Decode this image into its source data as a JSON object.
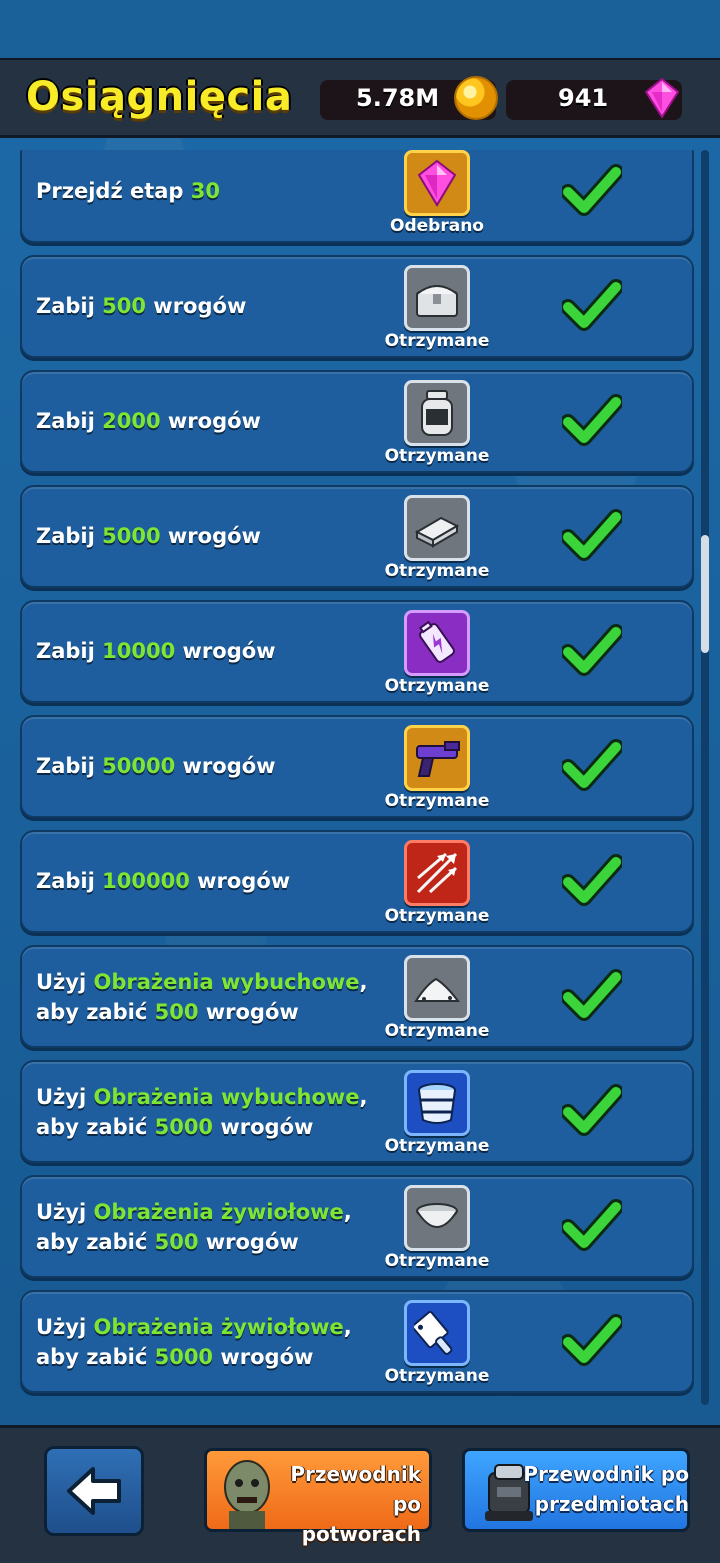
{
  "header": {
    "title": "Osiągnięcia",
    "coins": "5.78M",
    "gems": "941"
  },
  "achievements": [
    {
      "pre": "Przejdź etap ",
      "hl": "30",
      "post": "",
      "line2_pre": "",
      "line2_hl": "",
      "line2_post": "",
      "reward_icon": "gem-icon",
      "reward_label": "Odebrano"
    },
    {
      "pre": "Zabij ",
      "hl": "500",
      "post": " wrogów",
      "line2_pre": "",
      "line2_hl": "",
      "line2_post": "",
      "reward_icon": "chest-icon",
      "reward_label": "Otrzymane"
    },
    {
      "pre": "Zabij ",
      "hl": "2000",
      "post": " wrogów",
      "line2_pre": "",
      "line2_hl": "",
      "line2_post": "",
      "reward_icon": "jar-icon",
      "reward_label": "Otrzymane"
    },
    {
      "pre": "Zabij ",
      "hl": "5000",
      "post": " wrogów",
      "line2_pre": "",
      "line2_hl": "",
      "line2_post": "",
      "reward_icon": "ammo-box-icon",
      "reward_label": "Otrzymane"
    },
    {
      "pre": "Zabij ",
      "hl": "10000",
      "post": " wrogów",
      "line2_pre": "",
      "line2_hl": "",
      "line2_post": "",
      "reward_icon": "battery-icon",
      "reward_label": "Otrzymane"
    },
    {
      "pre": "Zabij ",
      "hl": "50000",
      "post": " wrogów",
      "line2_pre": "",
      "line2_hl": "",
      "line2_post": "",
      "reward_icon": "blaster-icon",
      "reward_label": "Otrzymane"
    },
    {
      "pre": "Zabij ",
      "hl": "100000",
      "post": " wrogów",
      "line2_pre": "",
      "line2_hl": "",
      "line2_post": "",
      "reward_icon": "arrows-icon",
      "reward_label": "Otrzymane"
    },
    {
      "pre": "Użyj ",
      "hl": "Obrażenia wybuchowe",
      "post": ",",
      "line2_pre": "aby zabić ",
      "line2_hl": "500",
      "line2_post": " wrogów",
      "reward_icon": "powder-pile-icon",
      "reward_label": "Otrzymane"
    },
    {
      "pre": "Użyj ",
      "hl": "Obrażenia wybuchowe",
      "post": ",",
      "line2_pre": "aby zabić ",
      "line2_hl": "5000",
      "line2_post": " wrogów",
      "reward_icon": "barrel-icon",
      "reward_label": "Otrzymane"
    },
    {
      "pre": "Użyj ",
      "hl": "Obrażenia żywiołowe",
      "post": ",",
      "line2_pre": "aby zabić ",
      "line2_hl": "500",
      "line2_post": " wrogów",
      "reward_icon": "bowl-icon",
      "reward_label": "Otrzymane"
    },
    {
      "pre": "Użyj ",
      "hl": "Obrażenia żywiołowe",
      "post": ",",
      "line2_pre": "aby zabić ",
      "line2_hl": "5000",
      "line2_post": " wrogów",
      "reward_icon": "cleaver-icon",
      "reward_label": "Otrzymane"
    }
  ],
  "footer": {
    "monster_guide_line1": "Przewodnik",
    "monster_guide_line2": "po potworach",
    "item_guide_line1": "Przewodnik po",
    "item_guide_line2": "przedmiotach"
  },
  "colors": {
    "highlight": "#7ee532",
    "title": "#f7ec27",
    "check": "#3bd43b"
  }
}
